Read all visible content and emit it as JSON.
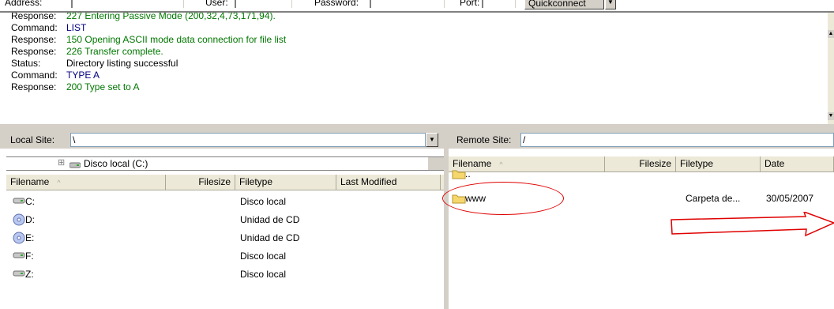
{
  "quickconnect": {
    "address_label": "Address:",
    "user_label": "User:",
    "password_label": "Password:",
    "port_label": "Port:",
    "button_label": "Quickconnect",
    "dropdown_glyph": "▼"
  },
  "log": [
    {
      "type": "Response:",
      "message": "227 Entering Passive Mode (200,32,4,73,171,94).",
      "color": "#007700"
    },
    {
      "type": "Command:",
      "message": "LIST",
      "color": "#000080"
    },
    {
      "type": "Response:",
      "message": "150 Opening ASCII mode data connection for file list",
      "color": "#007700"
    },
    {
      "type": "Response:",
      "message": "226 Transfer complete.",
      "color": "#007700"
    },
    {
      "type": "Status:",
      "message": "Directory listing successful",
      "color": "#000000"
    },
    {
      "type": "Command:",
      "message": "TYPE A",
      "color": "#000080"
    },
    {
      "type": "Response:",
      "message": "200 Type set to A",
      "color": "#007700"
    }
  ],
  "local": {
    "site_label": "Local Site:",
    "path": "\\",
    "tree_expander": "⊞",
    "tree_item": "Disco local (C:)",
    "columns": {
      "filename": "Filename",
      "filesize": "Filesize",
      "filetype": "Filetype",
      "modified": "Last Modified"
    },
    "sort_glyph": "^",
    "files": [
      {
        "name": "C:",
        "type": "Disco local",
        "icon": "hard-drive-icon"
      },
      {
        "name": "D:",
        "type": "Unidad de CD",
        "icon": "cd-drive-icon"
      },
      {
        "name": "E:",
        "type": "Unidad de CD",
        "icon": "cd-drive-icon"
      },
      {
        "name": "F:",
        "type": "Disco local",
        "icon": "hard-drive-icon"
      },
      {
        "name": "Z:",
        "type": "Disco local",
        "icon": "hard-drive-icon"
      }
    ]
  },
  "remote": {
    "site_label": "Remote Site:",
    "path": "/",
    "columns": {
      "filename": "Filename",
      "filesize": "Filesize",
      "filetype": "Filetype",
      "date": "Date"
    },
    "sort_glyph": "^",
    "files": [
      {
        "name": "..",
        "type": "",
        "date": "",
        "icon": "folder-icon"
      },
      {
        "name": "www",
        "type": "Carpeta de...",
        "date": "30/05/2007",
        "icon": "folder-icon"
      }
    ]
  },
  "colors": {
    "annotation": "#e00000",
    "panel_bg": "#d4d0c8",
    "header_bg": "#ece9d8"
  }
}
